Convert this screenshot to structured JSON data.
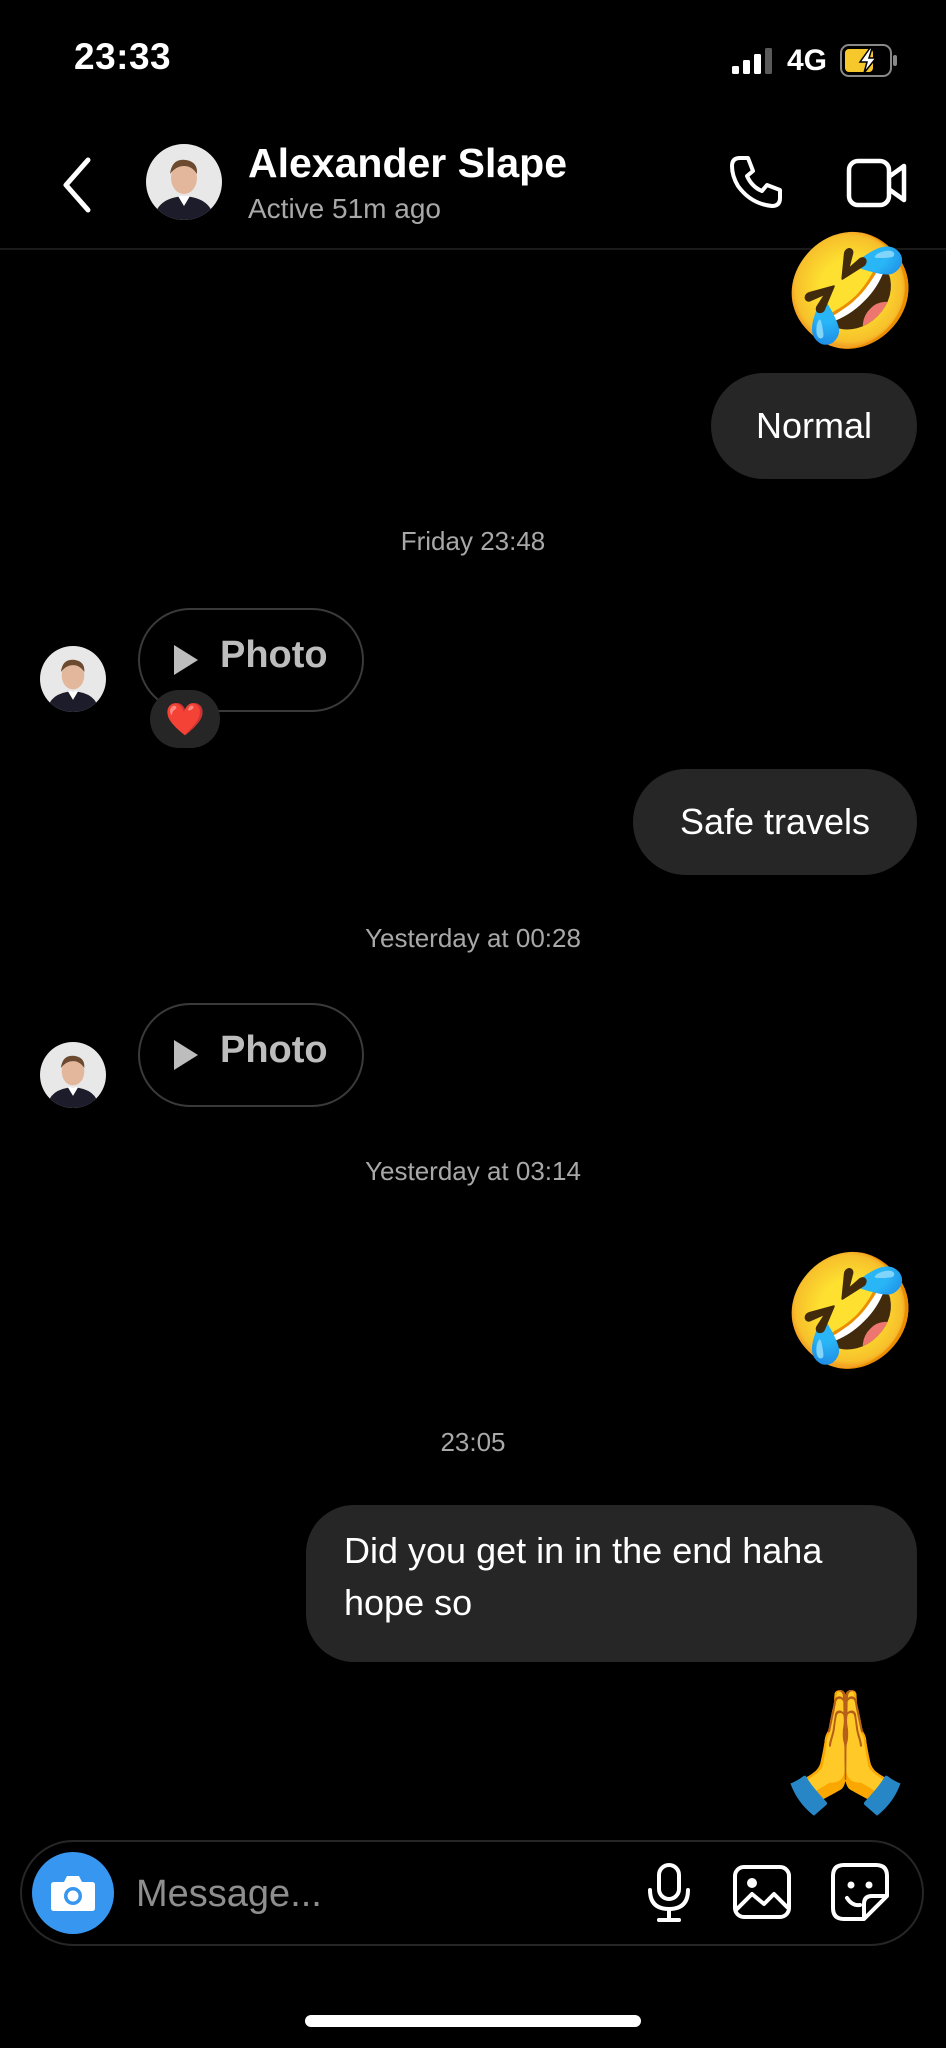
{
  "status_bar": {
    "time": "23:33",
    "network": "4G",
    "icons": [
      "signal-icon",
      "battery-charging-icon"
    ]
  },
  "header": {
    "name": "Alexander Slape",
    "status": "Active 51m ago",
    "icons": [
      "back-icon",
      "phone-icon",
      "video-icon"
    ]
  },
  "messages": {
    "emoji_top": "🤣",
    "msg1": "Normal",
    "ts1": "Friday 23:48",
    "photo1": "Photo",
    "reaction1": "❤️",
    "msg2": "Safe travels",
    "ts2": "Yesterday at 00:28",
    "photo2": "Photo",
    "ts3": "Yesterday at 03:14",
    "emoji_mid": "🤣",
    "ts4": "23:05",
    "msg3_line1": "Did you get in in the end haha",
    "msg3_line2": "hope so",
    "emoji_bottom": "🙏"
  },
  "composer": {
    "placeholder": "Message...",
    "icons": [
      "camera-icon",
      "microphone-icon",
      "gallery-icon",
      "sticker-icon"
    ]
  },
  "colors": {
    "background": "#000000",
    "bubble": "#262626",
    "accent": "#3797f0",
    "secondary_text": "#a8a8a8"
  }
}
